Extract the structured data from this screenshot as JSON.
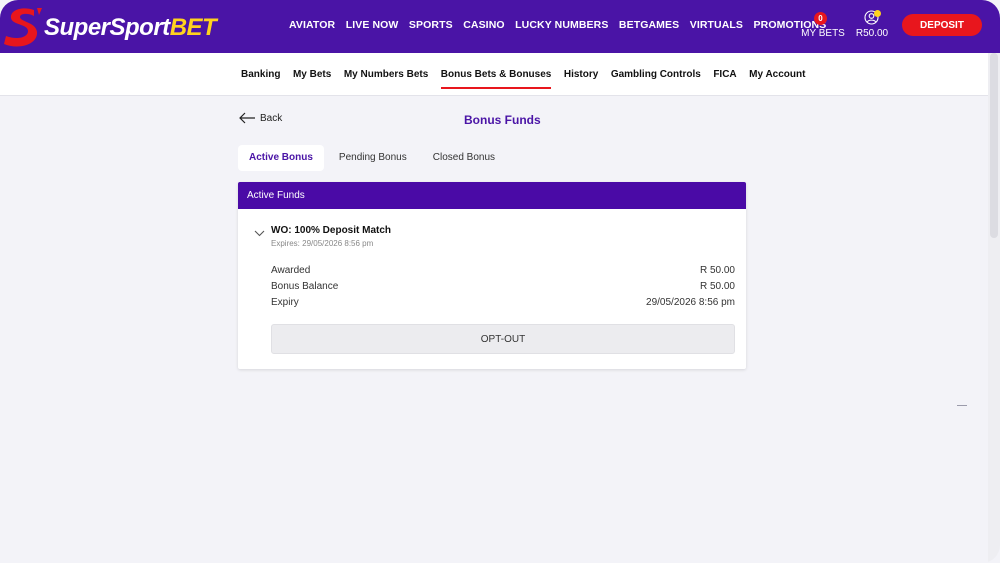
{
  "brand": {
    "name_main": "SuperSport",
    "name_accent": "BET",
    "colors": {
      "primary": "#4a14a6",
      "accent": "#e8161d",
      "yellow": "#ffd21e"
    }
  },
  "topnav": {
    "items": [
      "AVIATOR",
      "LIVE NOW",
      "SPORTS",
      "CASINO",
      "LUCKY NUMBERS",
      "BETGAMES",
      "VIRTUALS",
      "PROMOTIONS"
    ],
    "my_bets_count": "0",
    "my_bets_label": "MY BETS",
    "balance": "R50.00",
    "deposit_label": "DEPOSIT"
  },
  "subnav": {
    "items": [
      "Banking",
      "My Bets",
      "My Numbers Bets",
      "Bonus Bets & Bonuses",
      "History",
      "Gambling Controls",
      "FICA",
      "My Account"
    ],
    "active": "Bonus Bets & Bonuses"
  },
  "page": {
    "back_label": "Back",
    "title": "Bonus Funds",
    "tabs": [
      "Active Bonus",
      "Pending Bonus",
      "Closed Bonus"
    ],
    "active_tab": "Active Bonus"
  },
  "card": {
    "header": "Active Funds",
    "bonus_name": "WO: 100% Deposit Match",
    "expires_text": "Expires: 29/05/2026 8:56 pm",
    "rows": [
      {
        "label": "Awarded",
        "value": "R 50.00"
      },
      {
        "label": "Bonus Balance",
        "value": "R 50.00"
      },
      {
        "label": "Expiry",
        "value": "29/05/2026 8:56 pm"
      }
    ],
    "optout_label": "OPT-OUT"
  }
}
